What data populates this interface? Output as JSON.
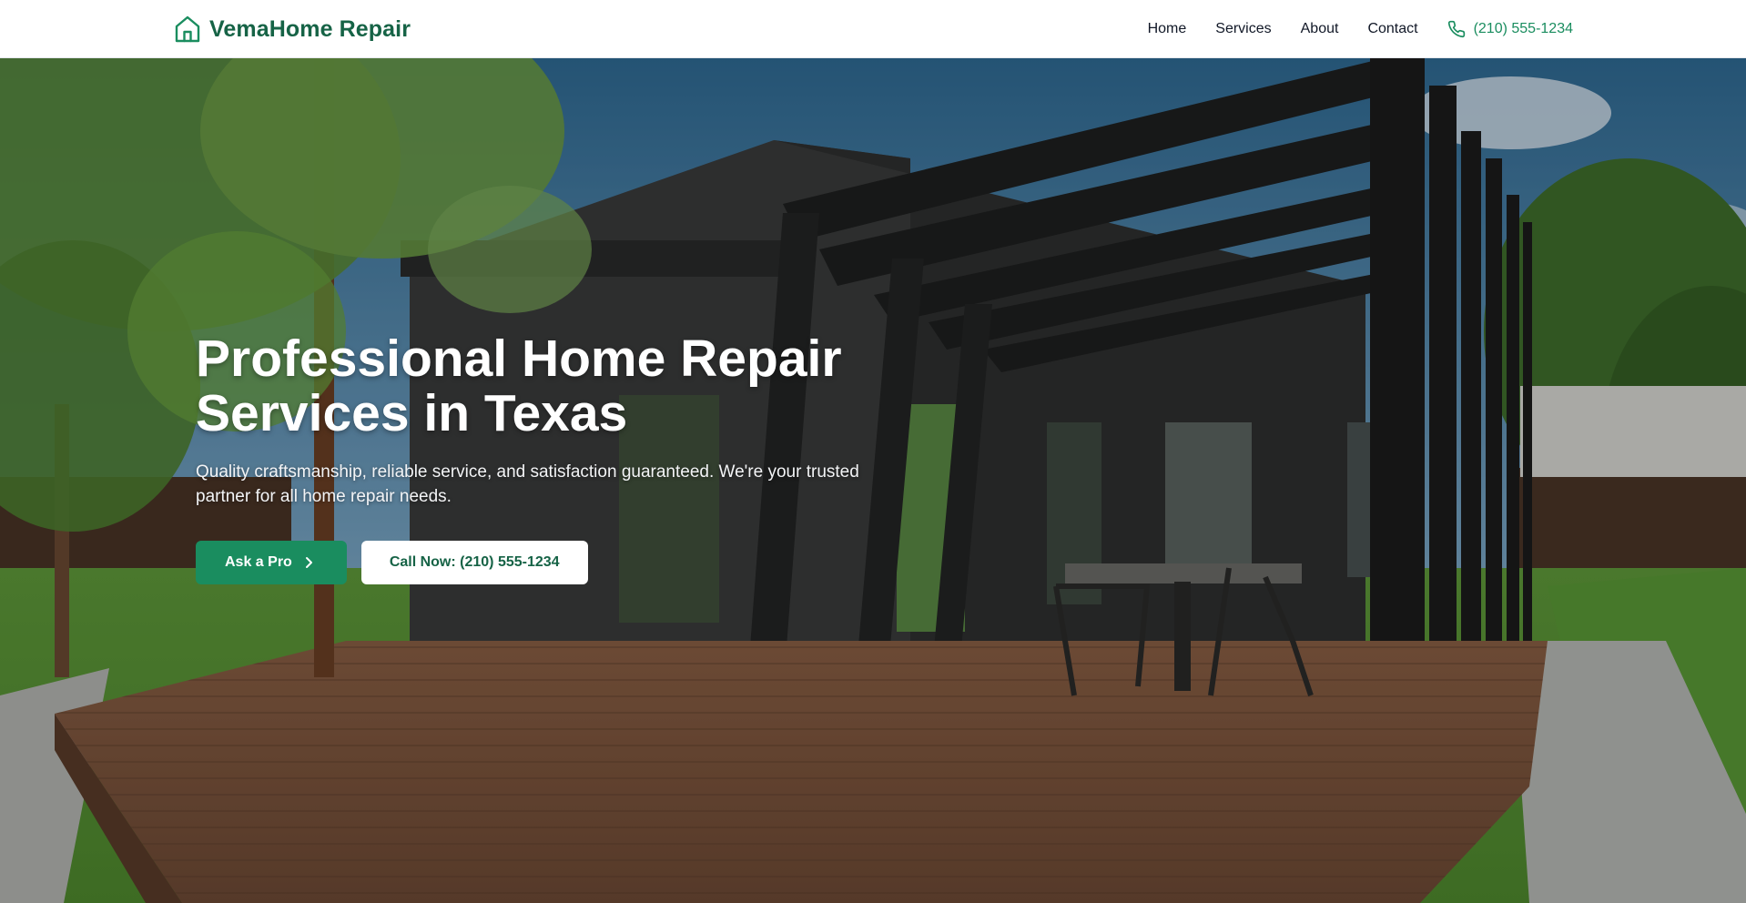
{
  "brand": {
    "name": "VemaHome Repair",
    "logo_icon": "house-icon",
    "primary_color": "#1a8d5f",
    "dark_color": "#166346"
  },
  "nav": {
    "items": [
      {
        "label": "Home"
      },
      {
        "label": "Services"
      },
      {
        "label": "About"
      },
      {
        "label": "Contact"
      }
    ],
    "phone_icon": "phone-icon",
    "phone": "(210) 555-1234"
  },
  "hero": {
    "title_line1": "Professional Home Repair",
    "title_line2": "Services in Texas",
    "subtitle": "Quality craftsmanship, reliable service, and satisfaction guaranteed. We're your trusted partner for all home repair needs.",
    "primary_button": "Ask a Pro",
    "primary_button_icon": "chevron-right-icon",
    "secondary_button": "Call Now: (210) 555-1234",
    "background_image": "modern-house-deck-pergola-photo"
  }
}
